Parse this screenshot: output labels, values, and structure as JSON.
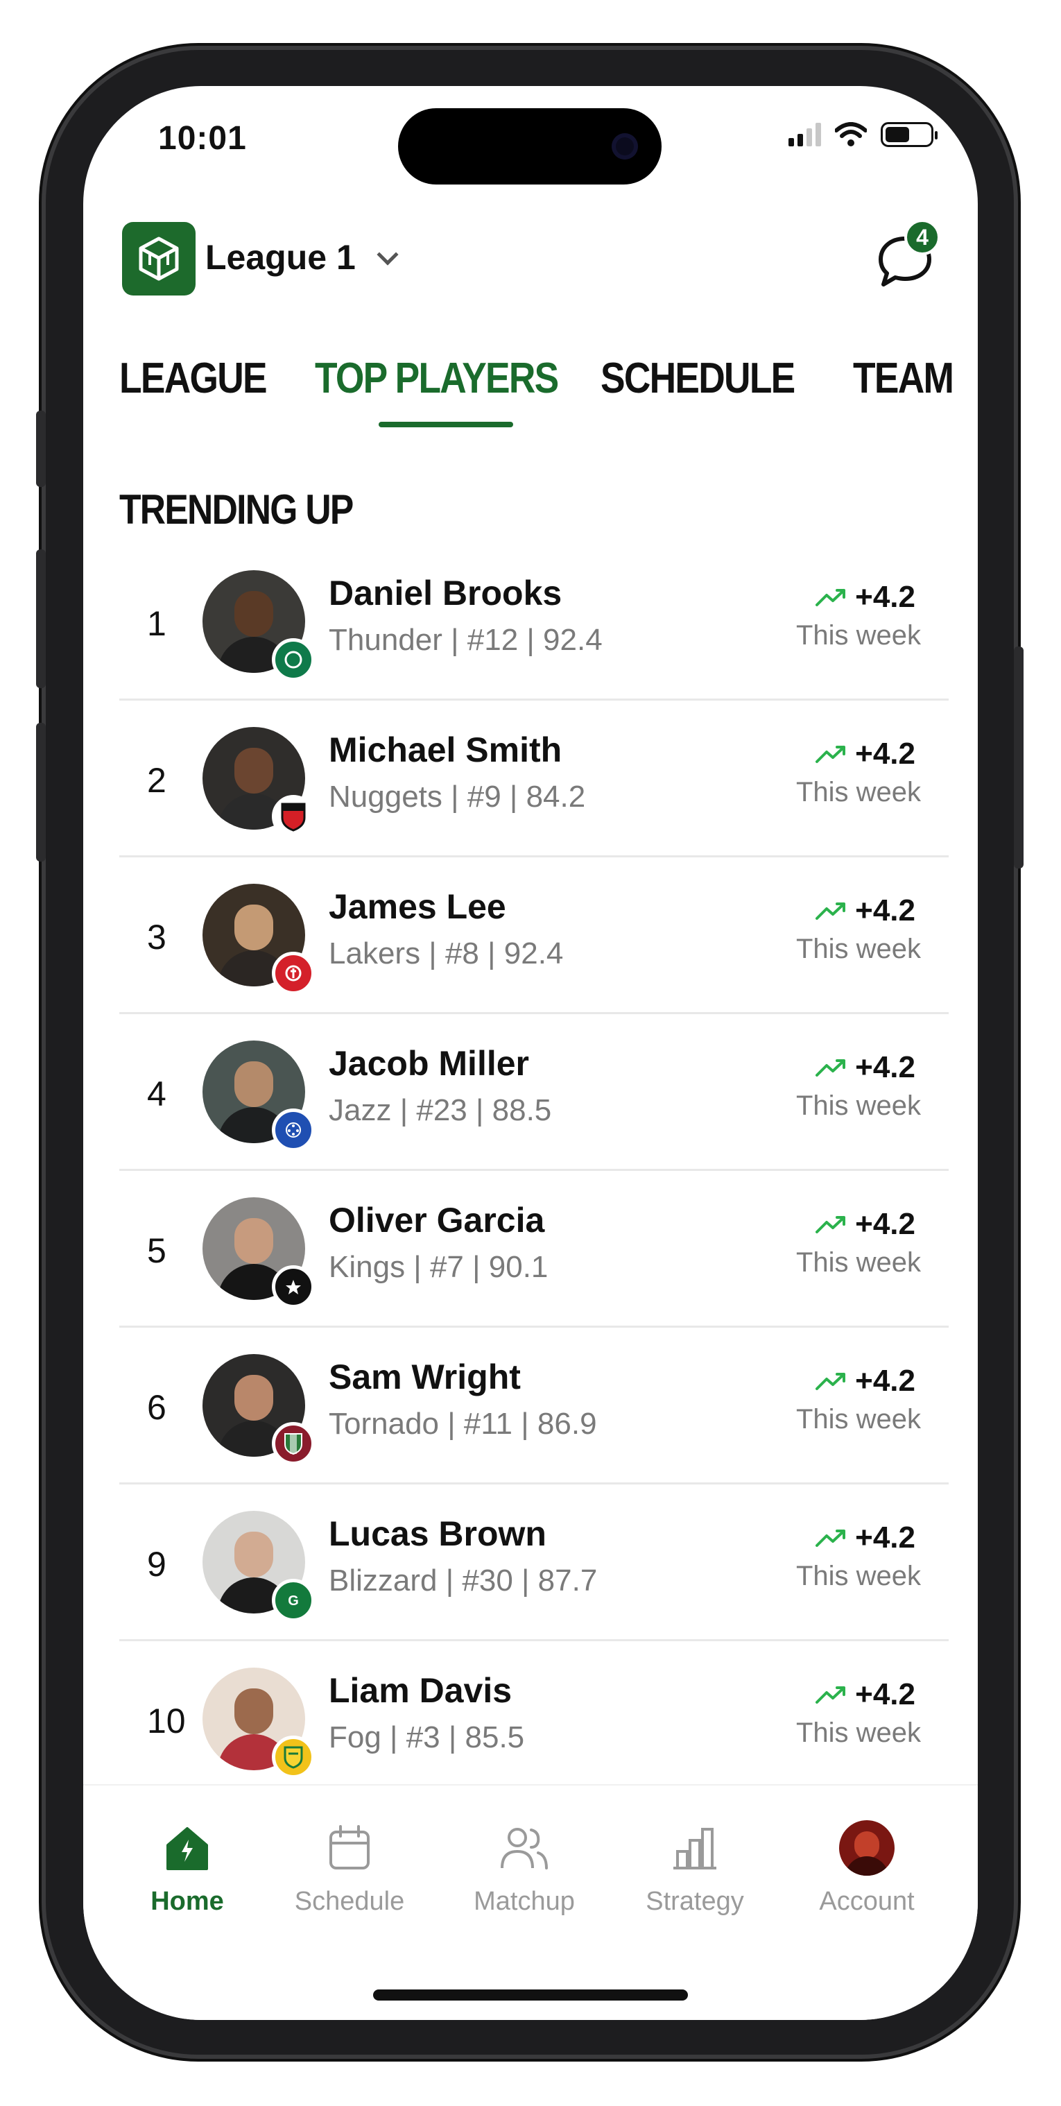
{
  "status_bar": {
    "time": "10:01"
  },
  "header": {
    "league_name": "League 1",
    "notification_count": "4"
  },
  "tabs": [
    {
      "label": "LEAGUE",
      "active": false
    },
    {
      "label": "TOP PLAYERS",
      "active": true
    },
    {
      "label": "SCHEDULE",
      "active": false
    },
    {
      "label": "TEAM",
      "active": false
    }
  ],
  "section": {
    "title": "TRENDING UP"
  },
  "players": [
    {
      "rank": "1",
      "name": "Daniel Brooks",
      "meta": "Thunder | #12 | 92.4",
      "change": "+4.2",
      "period": "This week"
    },
    {
      "rank": "2",
      "name": "Michael Smith",
      "meta": "Nuggets | #9 | 84.2",
      "change": "+4.2",
      "period": "This week"
    },
    {
      "rank": "3",
      "name": "James Lee",
      "meta": "Lakers | #8 | 92.4",
      "change": "+4.2",
      "period": "This week"
    },
    {
      "rank": "4",
      "name": "Jacob Miller",
      "meta": "Jazz | #23 | 88.5",
      "change": "+4.2",
      "period": "This week"
    },
    {
      "rank": "5",
      "name": "Oliver Garcia",
      "meta": "Kings | #7 | 90.1",
      "change": "+4.2",
      "period": "This week"
    },
    {
      "rank": "6",
      "name": "Sam Wright",
      "meta": "Tornado | #11 | 86.9",
      "change": "+4.2",
      "period": "This week"
    },
    {
      "rank": "9",
      "name": "Lucas Brown",
      "meta": "Blizzard | #30 | 87.7",
      "change": "+4.2",
      "period": "This week"
    },
    {
      "rank": "10",
      "name": "Liam Davis",
      "meta": "Fog | #3 | 85.5",
      "change": "+4.2",
      "period": "This week"
    }
  ],
  "nav": [
    {
      "label": "Home",
      "icon": "home-icon",
      "active": true
    },
    {
      "label": "Schedule",
      "icon": "calendar-icon",
      "active": false
    },
    {
      "label": "Matchup",
      "icon": "users-icon",
      "active": false
    },
    {
      "label": "Strategy",
      "icon": "bar-chart-icon",
      "active": false
    },
    {
      "label": "Account",
      "icon": "avatar",
      "active": false
    }
  ],
  "colors": {
    "accent": "#1a6b2c",
    "trend_green": "#2bb24c"
  }
}
